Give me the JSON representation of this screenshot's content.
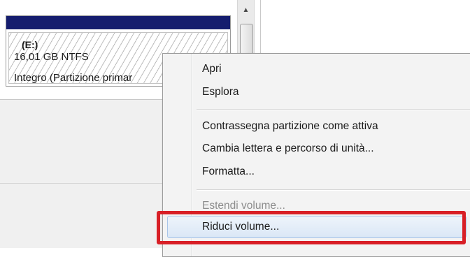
{
  "disk_pane": {
    "partition": {
      "drive_letter": "(E:)",
      "size_fs": "16,01 GB NTFS",
      "status": "Integro (Partizione primar"
    }
  },
  "context_menu": {
    "items": [
      {
        "label": "Apri",
        "enabled": true
      },
      {
        "label": "Esplora",
        "enabled": true
      },
      {
        "label": "Contrassegna partizione come attiva",
        "enabled": true
      },
      {
        "label": "Cambia lettera e percorso di unità...",
        "enabled": true
      },
      {
        "label": "Formatta...",
        "enabled": true
      },
      {
        "label": "Estendi volume...",
        "enabled": false
      },
      {
        "label": "Riduci volume...",
        "enabled": true,
        "highlighted": true
      }
    ]
  },
  "icons": {
    "scroll_up": "scroll-up-arrow-icon"
  },
  "colors": {
    "partition_header": "#151d6e",
    "highlight_border": "#d81f26"
  }
}
